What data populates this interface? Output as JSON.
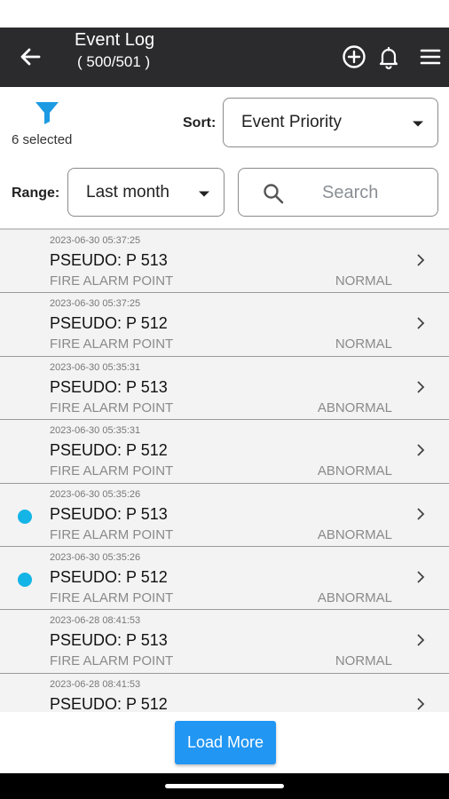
{
  "header": {
    "title": "Event Log",
    "subtitle": "( 500/501 )"
  },
  "filter": {
    "selected_label": "6 selected"
  },
  "sort": {
    "label": "Sort:",
    "value": "Event Priority"
  },
  "range": {
    "label": "Range:",
    "value": "Last month"
  },
  "search": {
    "placeholder": "Search"
  },
  "events": [
    {
      "timestamp": "2023-06-30 05:37:25",
      "name": "PSEUDO: P 513",
      "type": "FIRE ALARM POINT",
      "state": "NORMAL",
      "unread": false
    },
    {
      "timestamp": "2023-06-30 05:37:25",
      "name": "PSEUDO: P 512",
      "type": "FIRE ALARM POINT",
      "state": "NORMAL",
      "unread": false
    },
    {
      "timestamp": "2023-06-30 05:35:31",
      "name": "PSEUDO: P 513",
      "type": "FIRE ALARM POINT",
      "state": "ABNORMAL",
      "unread": false
    },
    {
      "timestamp": "2023-06-30 05:35:31",
      "name": "PSEUDO: P 512",
      "type": "FIRE ALARM POINT",
      "state": "ABNORMAL",
      "unread": false
    },
    {
      "timestamp": "2023-06-30 05:35:26",
      "name": "PSEUDO: P 513",
      "type": "FIRE ALARM POINT",
      "state": "ABNORMAL",
      "unread": true
    },
    {
      "timestamp": "2023-06-30 05:35:26",
      "name": "PSEUDO: P 512",
      "type": "FIRE ALARM POINT",
      "state": "ABNORMAL",
      "unread": true
    },
    {
      "timestamp": "2023-06-28 08:41:53",
      "name": "PSEUDO: P 513",
      "type": "FIRE ALARM POINT",
      "state": "NORMAL",
      "unread": false
    },
    {
      "timestamp": "2023-06-28 08:41:53",
      "name": "PSEUDO: P 512",
      "type": "",
      "state": "",
      "unread": false
    }
  ],
  "load_more_label": "Load More",
  "colors": {
    "appbar": "#2b2b2e",
    "accent": "#2196f3",
    "unread_dot": "#14b4e6"
  },
  "icons": {
    "back": "arrow-left-icon",
    "add": "add-circle-icon",
    "notifications": "bell-icon",
    "menu": "hamburger-menu-icon",
    "filter": "funnel-icon",
    "search": "magnifier-icon",
    "row": "chevron-right-icon"
  }
}
